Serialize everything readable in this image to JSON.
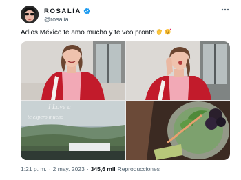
{
  "user": {
    "display_name": "ROSALÍA",
    "handle": "@rosalia",
    "verified_color": "#1d9bf0",
    "avatar_icon": "avatar-photo"
  },
  "tweet": {
    "text": "Adios México te amo mucho y te veo pronto",
    "emojis": [
      "waving-hand-emoji",
      "smiling-face-with-hearts-emoji"
    ]
  },
  "media": {
    "photos": [
      "photo-woman-red-jacket-window",
      "photo-woman-red-jacket-pose",
      "photo-window-writing-city-view",
      "photo-drink-with-blackberries"
    ],
    "window_writing": [
      "I Love u",
      "te espero mucho"
    ]
  },
  "meta": {
    "time": "1:21 p. m.",
    "separator": "·",
    "date": "2 may. 2023",
    "views_count": "345,6 mil",
    "views_label": "Reproducciones"
  },
  "colors": {
    "text": "#0f1419",
    "secondary": "#536471",
    "jacket": "#c21b2b"
  }
}
